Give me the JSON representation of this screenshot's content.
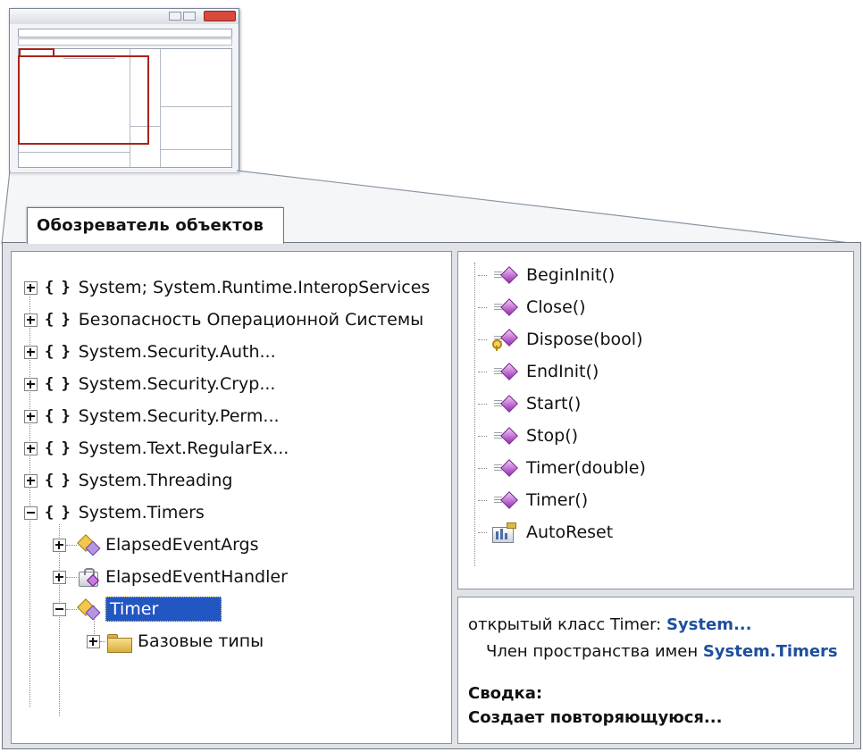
{
  "tab": {
    "title": "Обозреватель объектов"
  },
  "tree": {
    "namespaces": [
      {
        "label": "System; System.Runtime.InteropServices",
        "expander": "plus"
      },
      {
        "label": "Безопасность Операционной Системы",
        "expander": "plus"
      },
      {
        "label": "System.Security.Auth...",
        "expander": "plus"
      },
      {
        "label": "System.Security.Cryp...",
        "expander": "plus"
      },
      {
        "label": "System.Security.Perm...",
        "expander": "plus"
      },
      {
        "label": "System.Text.RegularEx...",
        "expander": "plus"
      },
      {
        "label": "System.Threading",
        "expander": "plus"
      },
      {
        "label": "System.Timers",
        "expander": "minus"
      }
    ],
    "namespace_icon": "{ }",
    "types": [
      {
        "label": "ElapsedEventArgs",
        "icon": "class-icon",
        "expander": "plus"
      },
      {
        "label": "ElapsedEventHandler",
        "icon": "delegate-icon",
        "expander": "plus"
      },
      {
        "label": "Timer",
        "icon": "class-icon",
        "expander": "minus",
        "selected": true
      }
    ],
    "base_types": {
      "label": "Базовые типы",
      "icon": "folder-icon",
      "expander": "plus"
    }
  },
  "members": [
    {
      "label": "BeginInit()",
      "icon": "method-icon"
    },
    {
      "label": "Close()",
      "icon": "method-icon"
    },
    {
      "label": "Dispose(bool)",
      "icon": "protected-method-icon"
    },
    {
      "label": "EndInit()",
      "icon": "method-icon"
    },
    {
      "label": "Start()",
      "icon": "method-icon"
    },
    {
      "label": "Stop()",
      "icon": "method-icon"
    },
    {
      "label": "Timer(double)",
      "icon": "method-icon"
    },
    {
      "label": "Timer()",
      "icon": "method-icon"
    },
    {
      "label": "AutoReset",
      "icon": "property-icon"
    }
  ],
  "summary": {
    "line1_prefix": "открытый класс Timer: ",
    "line1_link": "System...",
    "line2_prefix": "Член пространства имен ",
    "line2_link": "System.Timers",
    "heading": "Сводка:",
    "text": "Создает повторяющуюся..."
  },
  "colors": {
    "selection": "#2256c2",
    "link": "#1f4f9c",
    "highlight_frame": "#a8241c",
    "method_icon": "#9b2cb5"
  }
}
